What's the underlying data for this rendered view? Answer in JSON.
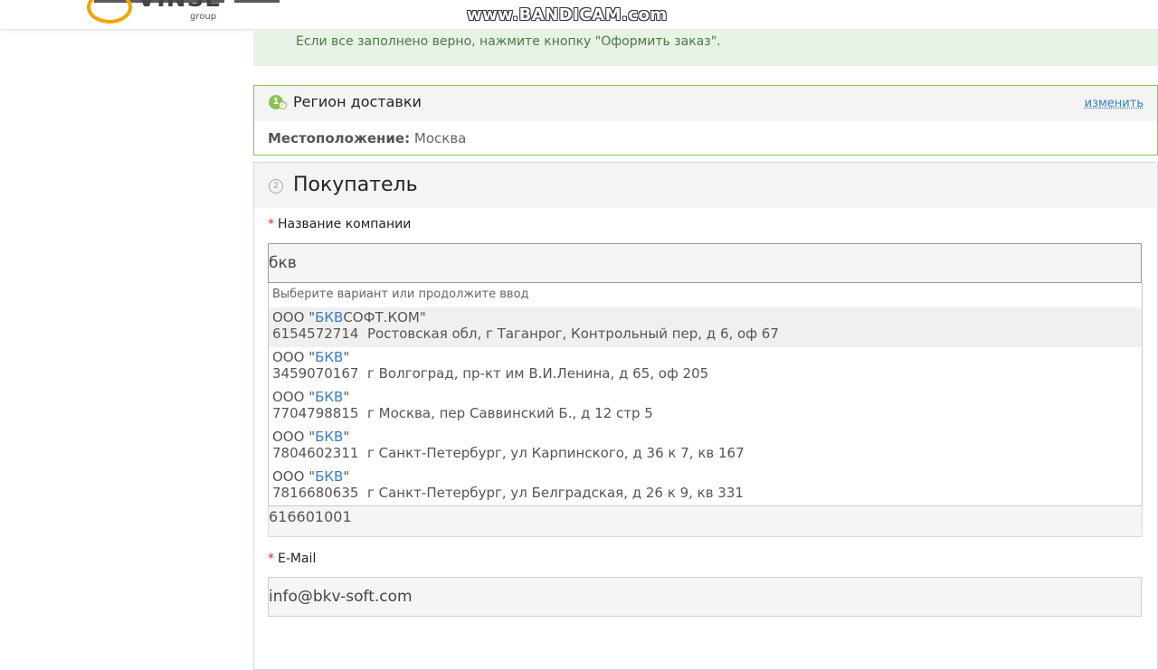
{
  "header": {
    "logo_text": "VINSER",
    "logo_sub": "group",
    "watermark": "www.BANDICAM.com"
  },
  "notice": {
    "text": "Если все заполнено верно, нажмите кнопку \"Оформить заказ\"."
  },
  "region": {
    "step": "1",
    "title": "Регион доставки",
    "change_label": "изменить",
    "location_label": "Местоположение:",
    "location_value": "Москва"
  },
  "buyer": {
    "step": "2",
    "title": "Покупатель",
    "company": {
      "required_mark": "*",
      "label": "Название компании",
      "value": "бкв"
    },
    "suggestions": {
      "hint": "Выберите вариант или продолжите ввод",
      "items": [
        {
          "prefix": "ООО \"",
          "match": "БКВ",
          "suffix": "СОФТ.КОМ\"",
          "inn": "6154572714",
          "address": "Ростовская обл, г Таганрог, Контрольный пер, д 6, оф 67"
        },
        {
          "prefix": "ООО \"",
          "match": "БКВ",
          "suffix": "\"",
          "inn": "3459070167",
          "address": "г Волгоград, пр-кт им В.И.Ленина, д 65, оф 205"
        },
        {
          "prefix": "ООО \"",
          "match": "БКВ",
          "suffix": "\"",
          "inn": "7704798815",
          "address": "г Москва, пер Саввинский Б., д 12 стр 5"
        },
        {
          "prefix": "ООО \"",
          "match": "БКВ",
          "suffix": "\"",
          "inn": "7804602311",
          "address": "г Санкт-Петербург, ул Карпинского, д 36 к 7, кв 167"
        },
        {
          "prefix": "ООО \"",
          "match": "БКВ",
          "suffix": "\"",
          "inn": "7816680635",
          "address": "г Санкт-Петербург, ул Белградская, д 26 к 9, кв 331"
        }
      ]
    },
    "kpp_value": "616601001",
    "email": {
      "required_mark": "*",
      "label": "E-Mail",
      "value": "info@bkv-soft.com"
    }
  },
  "colors": {
    "accent_green": "#8cc152",
    "link_blue": "#3a7bc8",
    "notice_bg": "#e7f3e4",
    "required_red": "#d9302a"
  }
}
